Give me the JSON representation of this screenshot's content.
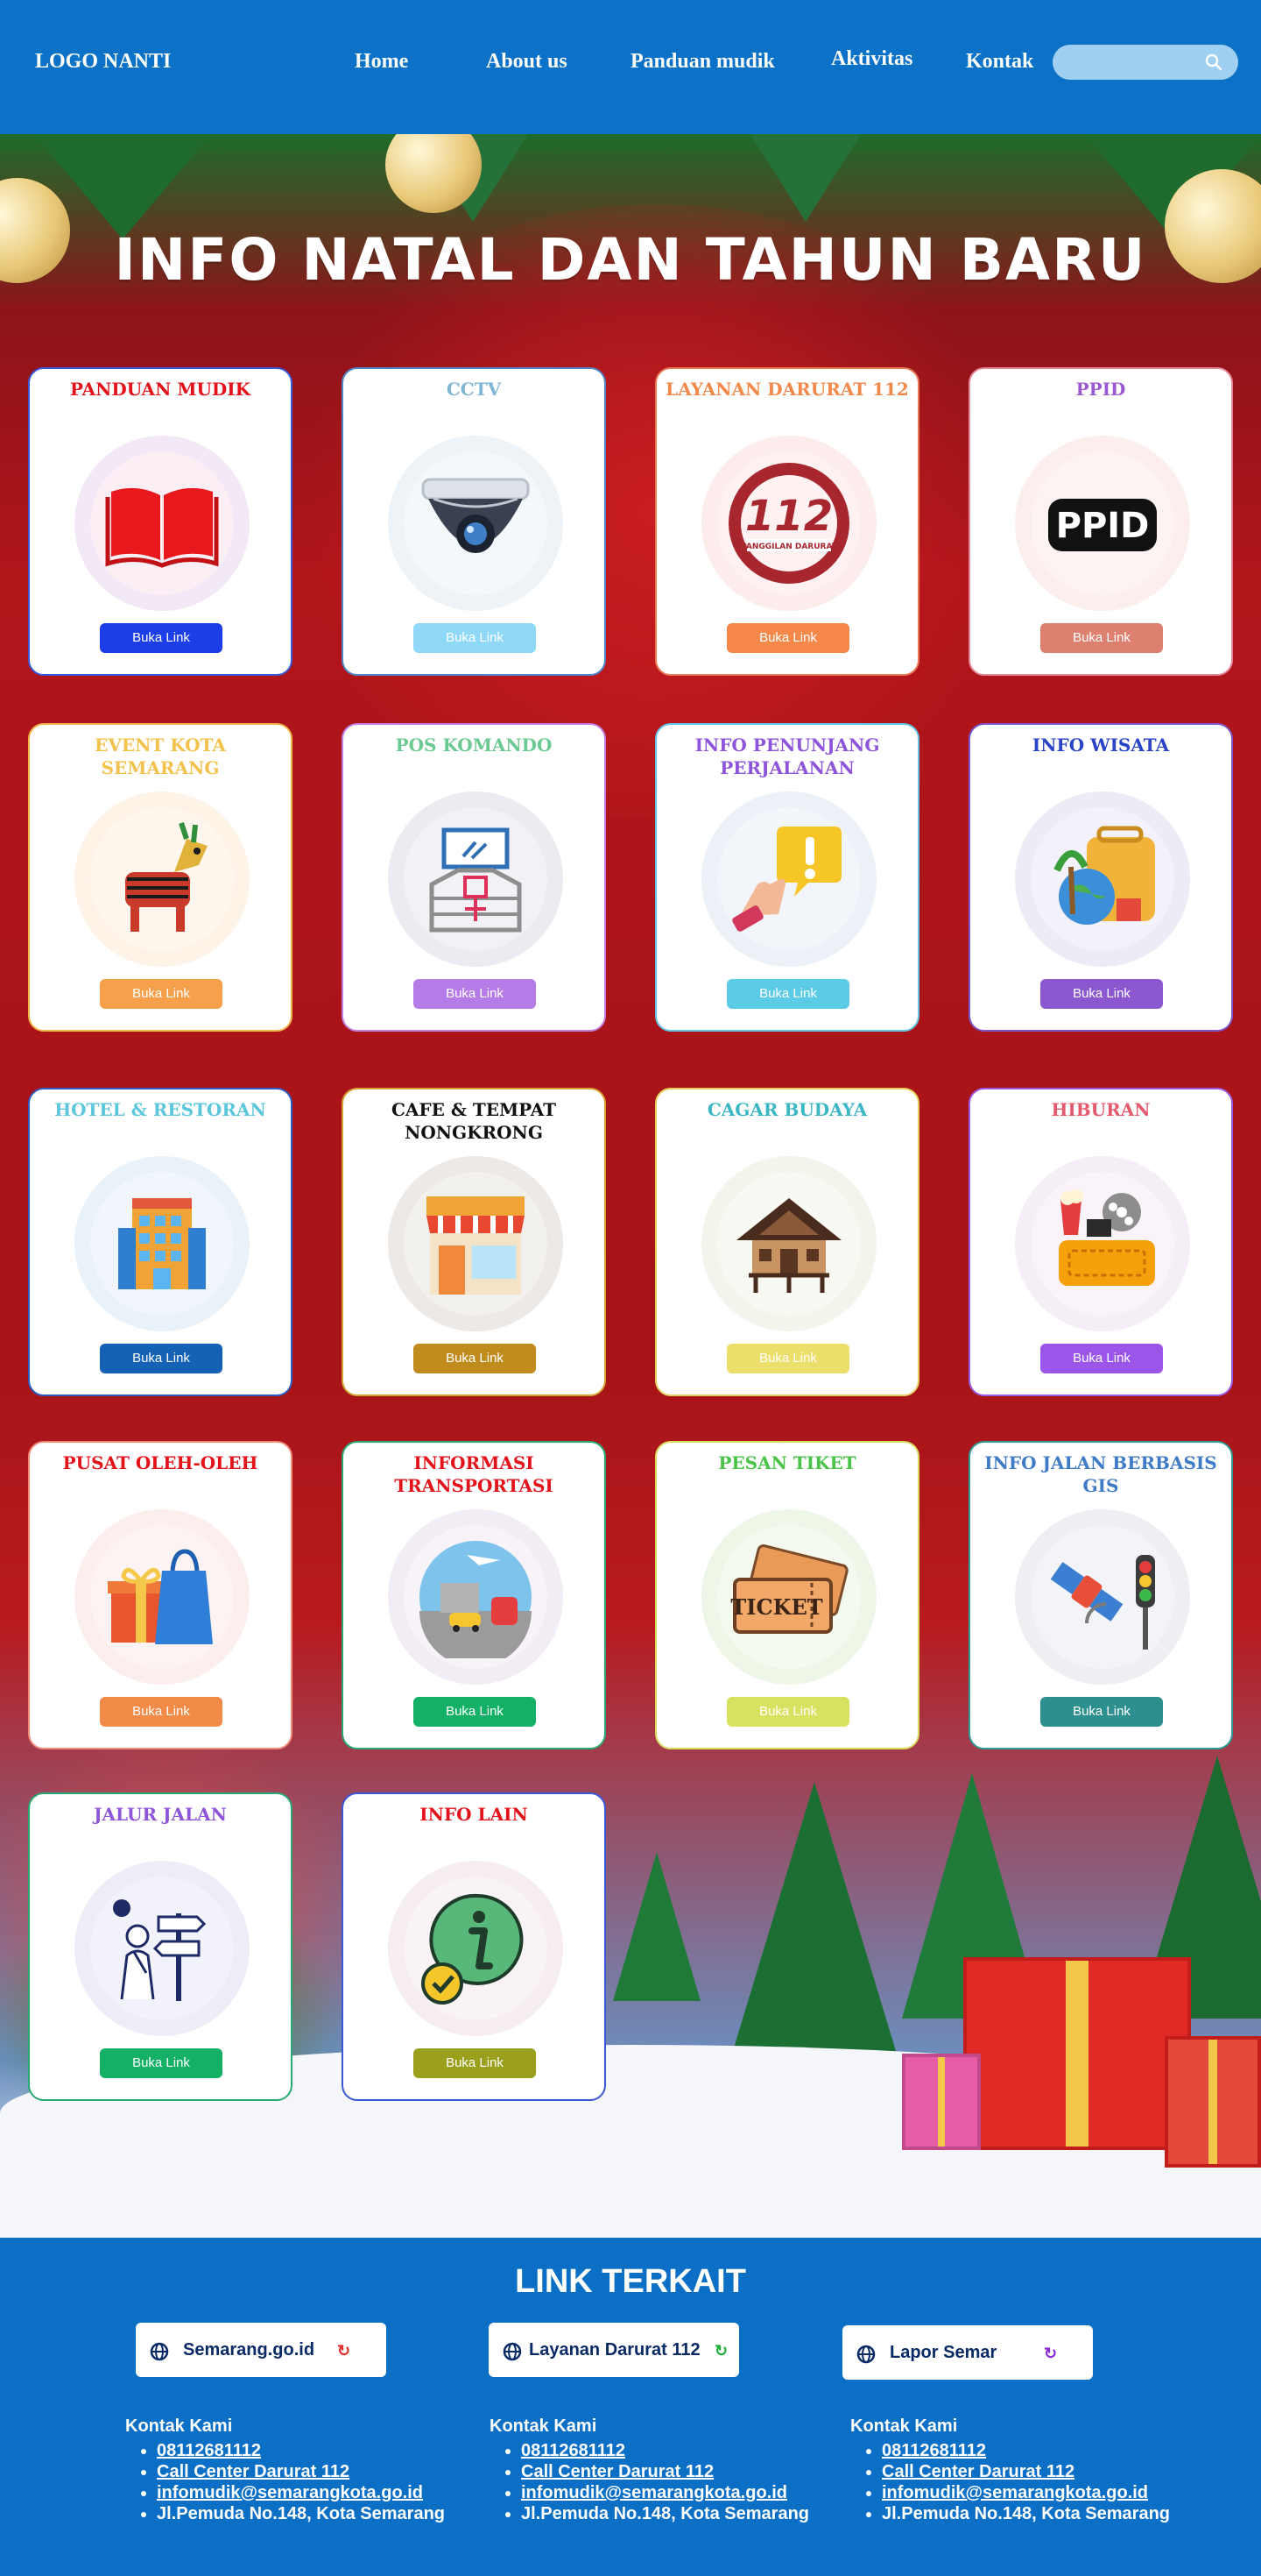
{
  "nav": {
    "logo": "LOGO NANTI",
    "links": [
      "Home",
      "About us",
      "Panduan mudik",
      "Aktivitas",
      "Kontak"
    ],
    "search_placeholder": ""
  },
  "hero": {
    "title": "INFO NATAL DAN TAHUN BARU"
  },
  "cards": [
    {
      "title": "PANDUAN MUDIK",
      "button": "Buka Link",
      "title_color": "#e3121b",
      "button_color": "#1c3ee6",
      "border_color": "#3a57d8",
      "icon": "book-icon"
    },
    {
      "title": "CCTV",
      "button": "Buka Link",
      "title_color": "#7fb6d6",
      "button_color": "#8fd8f7",
      "border_color": "#4f86c9",
      "icon": "cctv-camera-icon"
    },
    {
      "title": "LAYANAN DARURAT 112",
      "button": "Buka Link",
      "title_color": "#f2894b",
      "button_color": "#f6894a",
      "border_color": "#e87a56",
      "icon": "emergency-112-icon"
    },
    {
      "title": "PPID",
      "button": "Buka Link",
      "title_color": "#9b59d1",
      "button_color": "#de8070",
      "border_color": "#e3889a",
      "icon": "ppid-logo-icon"
    },
    {
      "title": "EVENT KOTA SEMARANG",
      "button": "Buka Link",
      "title_color": "#f3c24d",
      "button_color": "#f6a04c",
      "border_color": "#f2b54a",
      "icon": "dragon-warak-icon"
    },
    {
      "title": "POS KOMANDO",
      "button": "Buka Link",
      "title_color": "#6cc992",
      "button_color": "#b57be6",
      "border_color": "#c17ee0",
      "icon": "command-post-icon"
    },
    {
      "title": "INFO PENUNJANG PERJALANAN",
      "button": "Buka Link",
      "title_color": "#8e55dc",
      "button_color": "#5bcbe6",
      "border_color": "#63c5e5",
      "icon": "info-alert-hand-icon"
    },
    {
      "title": "INFO WISATA",
      "button": "Buka Link",
      "title_color": "#2a44c8",
      "button_color": "#8c58d0",
      "border_color": "#7b55c9",
      "icon": "travel-suitcase-icon"
    },
    {
      "title": "HOTEL & RESTORAN",
      "button": "Buka Link",
      "title_color": "#5cc7dc",
      "button_color": "#1561b5",
      "border_color": "#2d5bc4",
      "icon": "hotel-building-icon"
    },
    {
      "title": "CAFE & TEMPAT NONGKRONG",
      "button": "Buka Link",
      "title_color": "#111111",
      "button_color": "#c08c1e",
      "border_color": "#d2a232",
      "icon": "cafe-shop-icon"
    },
    {
      "title": "CAGAR BUDAYA",
      "button": "Buka Link",
      "title_color": "#3bb7c4",
      "button_color": "#ecdf6b",
      "border_color": "#e4cf5d",
      "icon": "traditional-house-icon"
    },
    {
      "title": "HIBURAN",
      "button": "Buka Link",
      "title_color": "#e35a6e",
      "button_color": "#9b55e8",
      "border_color": "#9a5be4",
      "icon": "cinema-entertainment-icon"
    },
    {
      "title": "PUSAT OLEH-OLEH",
      "button": "Buka Link",
      "title_color": "#e3121b",
      "button_color": "#f28a48",
      "border_color": "#ef8d7a",
      "icon": "gift-bag-icon"
    },
    {
      "title": "INFORMASI TRANSPORTASI",
      "button": "Buka Link",
      "title_color": "#e3121b",
      "button_color": "#13b066",
      "border_color": "#2aa873",
      "icon": "transportation-icon"
    },
    {
      "title": "PESAN TIKET",
      "button": "Buka Link",
      "title_color": "#49c448",
      "button_color": "#d8e261",
      "border_color": "#d8dc5b",
      "icon": "ticket-icon"
    },
    {
      "title": "INFO JALAN BERBASIS GIS",
      "button": "Buka Link",
      "title_color": "#3f7bc7",
      "button_color": "#2e8f8f",
      "border_color": "#2f9b94",
      "icon": "satellite-traffic-icon"
    },
    {
      "title": "JALUR JALAN",
      "button": "Buka Link",
      "title_color": "#8d56d9",
      "button_color": "#13b066",
      "border_color": "#2aa873",
      "icon": "route-signpost-icon"
    },
    {
      "title": "INFO LAIN",
      "button": "Buka Link",
      "title_color": "#e3121b",
      "button_color": "#9aa01c",
      "border_color": "#3a57d8",
      "icon": "info-chat-icon"
    }
  ],
  "footer": {
    "title": "LINK TERKAIT",
    "links": [
      {
        "label": "Semarang.go.id",
        "ext_color": "#e22b2b"
      },
      {
        "label": "Layanan Darurat 112",
        "ext_color": "#1fae3a"
      },
      {
        "label": "Lapor Semar",
        "ext_color": "#8a2bd6"
      }
    ],
    "contact_heading": "Kontak Kami",
    "contacts": [
      [
        "08112681112",
        "Call Center Darurat 112",
        "infomudik@semarangkota.go.id",
        "Jl.Pemuda No.148, Kota Semarang"
      ],
      [
        "08112681112",
        "Call Center Darurat 112",
        "infomudik@semarangkota.go.id",
        "Jl.Pemuda No.148, Kota Semarang"
      ],
      [
        "08112681112",
        "Call Center Darurat 112",
        "infomudik@semarangkota.go.id",
        "Jl.Pemuda No.148, Kota Semarang"
      ]
    ]
  }
}
